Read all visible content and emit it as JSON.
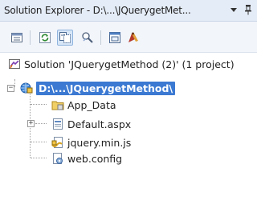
{
  "window": {
    "title": "Solution Explorer - D:\\...\\JQuerygetMet...",
    "dropdown_glyph": "▼",
    "pin_glyph": "ᴾ"
  },
  "toolbar": {
    "buttons": [
      {
        "name": "properties-button",
        "icon": "properties-icon"
      },
      {
        "name": "refresh-button",
        "icon": "refresh-icon"
      },
      {
        "name": "show-all-files-button",
        "icon": "show-all-files-icon",
        "active": true
      },
      {
        "name": "nest-related-files-button",
        "icon": "nest-related-files-icon"
      },
      {
        "name": "view-code-button",
        "icon": "view-code-icon"
      },
      {
        "name": "view-designer-button",
        "icon": "view-designer-icon"
      }
    ]
  },
  "tree": {
    "solution": {
      "label": "Solution 'JQuerygetMethod (2)' (1 project)",
      "icon": "solution-icon"
    },
    "project": {
      "label": "D:\\...\\JQuerygetMethod\\",
      "icon": "web-project-icon",
      "expander": "−",
      "selected": true
    },
    "items": [
      {
        "label": "App_Data",
        "icon": "folder-icon"
      },
      {
        "label": "Default.aspx",
        "icon": "aspx-page-icon",
        "expander": "+"
      },
      {
        "label": "jquery.min.js",
        "icon": "javascript-file-icon"
      },
      {
        "label": "web.config",
        "icon": "config-file-icon"
      }
    ]
  },
  "colors": {
    "titlebar": "#e4ecf7",
    "selection": "#3b79d2",
    "toolbar": "#f2f5fa"
  }
}
